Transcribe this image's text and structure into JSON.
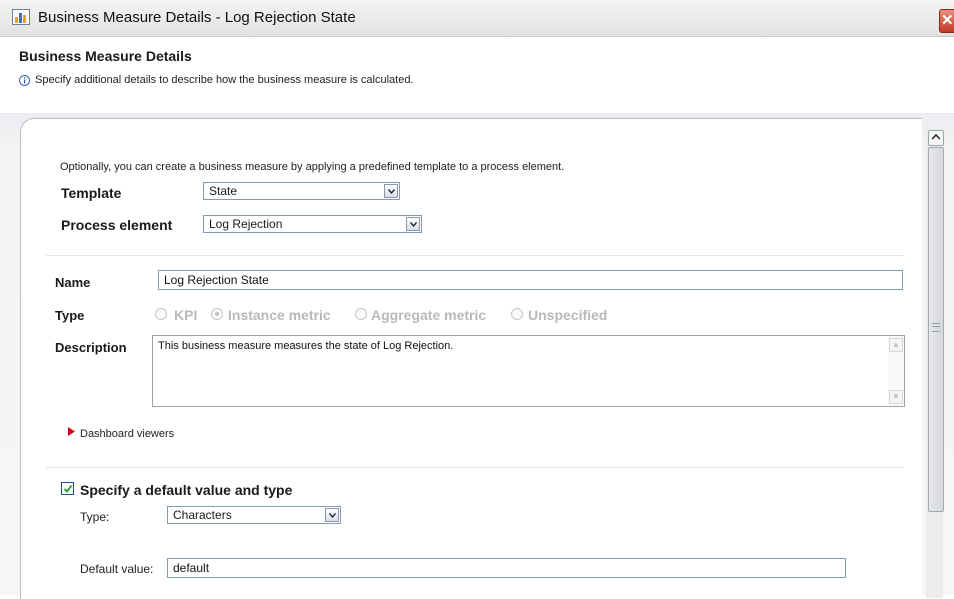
{
  "window": {
    "title": "Business Measure Details - Log Rejection State",
    "close_symbol": "✕"
  },
  "header": {
    "title": "Business Measure Details",
    "description": "Specify additional details to describe how the business measure is calculated."
  },
  "template_section": {
    "intro": "Optionally, you can create a business measure by applying a predefined template to a process element.",
    "template_label": "Template",
    "template_value": "State",
    "process_element_label": "Process element",
    "process_element_value": "Log Rejection"
  },
  "measure": {
    "name_label": "Name",
    "name_value": "Log Rejection State",
    "type_label": "Type",
    "type_options": [
      {
        "label": "KPI",
        "selected": false
      },
      {
        "label": "Instance metric",
        "selected": true
      },
      {
        "label": "Aggregate metric",
        "selected": false
      },
      {
        "label": "Unspecified",
        "selected": false
      }
    ],
    "description_label": "Description",
    "description_value": "This business measure measures the state of Log Rejection.",
    "dashboard_viewers": "Dashboard viewers"
  },
  "default_section": {
    "checkbox_label": "Specify a default value and type",
    "checked": true,
    "type_label": "Type:",
    "type_value": "Characters",
    "default_value_label": "Default value:",
    "default_value": "default"
  },
  "icons": {
    "app": "bar-chart-icon",
    "info": "info-icon",
    "dropdown": "chevron-down-icon",
    "expand": "triangle-right-icon"
  },
  "colors": {
    "close_button": "#c23a22",
    "field_border": "#7f9db9",
    "expand_arrow": "#d0021b",
    "disabled_text": "#b9b9b9"
  }
}
